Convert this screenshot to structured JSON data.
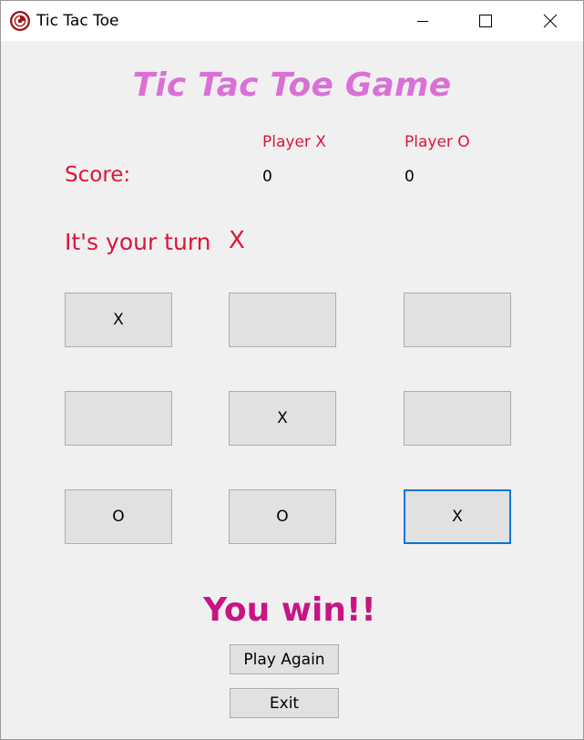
{
  "window": {
    "title": "Tic Tac Toe",
    "icon": "app-icon",
    "controls": [
      "minimize-icon",
      "maximize-icon",
      "close-icon"
    ]
  },
  "heading": "Tic Tac Toe Game",
  "players": {
    "x_label": "Player X",
    "o_label": "Player O"
  },
  "score": {
    "label": "Score:",
    "x": "0",
    "o": "0"
  },
  "turn": {
    "label": "It's your turn",
    "value": "X"
  },
  "board": {
    "cells": [
      [
        "X",
        "",
        ""
      ],
      [
        "",
        "X",
        ""
      ],
      [
        "O",
        "O",
        "X"
      ]
    ],
    "focused_cell": "2,2"
  },
  "result": "You win!!",
  "buttons": {
    "play_again": "Play Again",
    "exit": "Exit"
  },
  "colors": {
    "heading": "#da70d6",
    "labels": "#dc143c",
    "result": "#c71585",
    "focus": "#0078d7"
  }
}
